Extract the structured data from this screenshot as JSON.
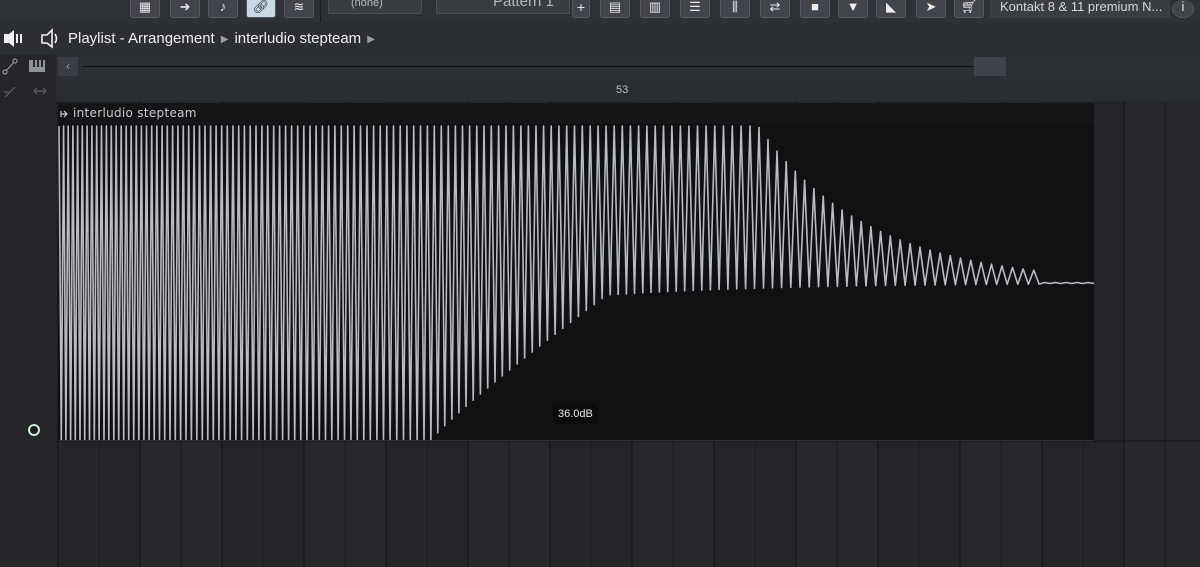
{
  "toolbar": {
    "channel_selector_value": "(none)",
    "pattern_selector_value": "Pattern 1",
    "pattern_add_label": "+",
    "plugin_label": "Kontakt 8 & 11 premium N...",
    "icons": [
      "piano-roll-icon",
      "arrow-right-icon",
      "note-icon",
      "link-icon",
      "chord-icon",
      "plug-icon",
      "pattern-prev-icon",
      "step-seq-icon",
      "song-mode-icon",
      "mixer-icon",
      "channel-rack-icon",
      "channel-icon",
      "undo-icon",
      "stop-icon",
      "microphone-icon",
      "dj-icon",
      "render-icon",
      "shop-icon",
      "info-icon"
    ]
  },
  "playlist": {
    "title": "Playlist - Arrangement",
    "clip_path": "interludio stepteam",
    "bar_number": "53",
    "clip_name": "interludio stepteam",
    "clip_icon": "automation-clip-icon",
    "tooltip": "36.0dB"
  },
  "colors": {
    "background": "#1f2125",
    "clip_bg": "#101113",
    "waveform": "#b8bcc0",
    "active_button": "#c7d9e4"
  }
}
